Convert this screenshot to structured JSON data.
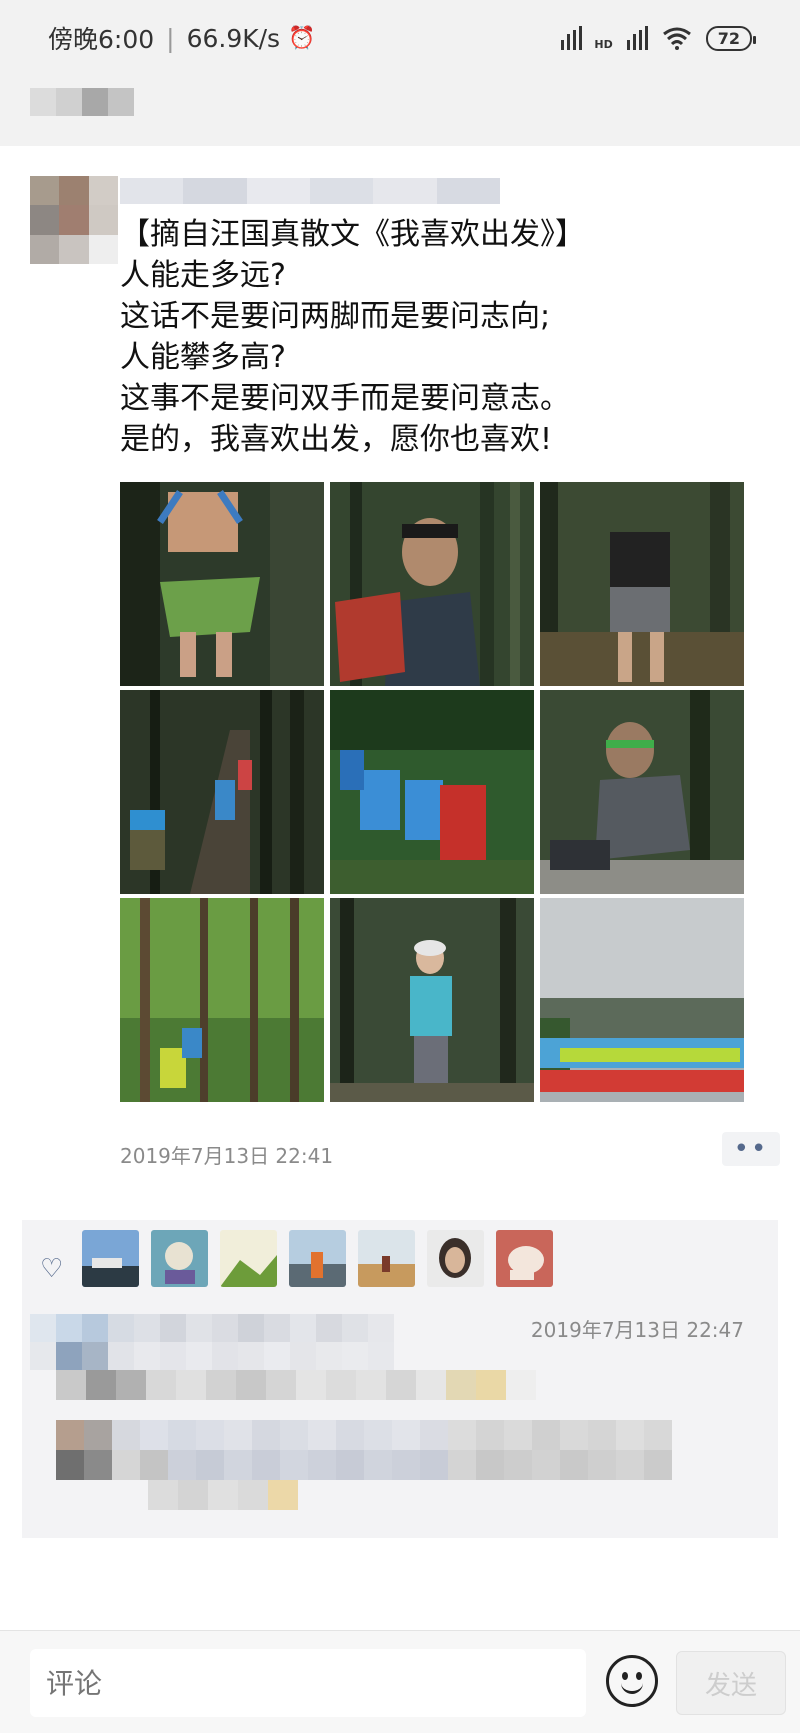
{
  "status_bar": {
    "time": "傍晚6:00",
    "network_speed": "66.9K/s",
    "alarm_icon": "alarm-icon",
    "signal_label": "HD",
    "wifi_icon": "wifi-icon",
    "battery": "72"
  },
  "post": {
    "text_lines": [
      "【摘自汪国真散文《我喜欢出发》】",
      "人能走多远?",
      "这话不是要问两脚而是要问志向;",
      "人能攀多高?",
      "这事不是要问双手而是要问意志。",
      "是的，我喜欢出发，愿你也喜欢!"
    ],
    "timestamp": "2019年7月13日 22:41",
    "more_icon": "more-dots-icon",
    "photos": [
      "runner-in-forest",
      "man-with-red-backpack",
      "hiker-walking-away",
      "hikers-on-forest-trail",
      "hikers-with-backpacks",
      "man-with-headband",
      "forest-path",
      "woman-hiker",
      "group-photo-with-banner"
    ]
  },
  "likes": {
    "heart_icon": "heart-icon",
    "avatars": [
      "avatar-1",
      "avatar-2",
      "avatar-3",
      "avatar-4",
      "avatar-5",
      "avatar-6",
      "avatar-7"
    ]
  },
  "comments": {
    "timestamp": "2019年7月13日 22:47"
  },
  "bottom_bar": {
    "comment_placeholder": "评论",
    "emoji_icon": "emoji-icon",
    "send_label": "发送"
  }
}
